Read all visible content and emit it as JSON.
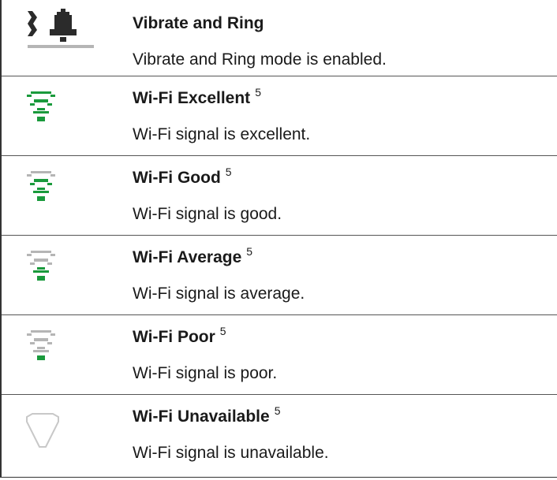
{
  "colors": {
    "green": "#1a9a3c",
    "gray": "#b5b5b5",
    "dark": "#1a1a1a",
    "icon_dark": "#2b2b2b"
  },
  "rows": [
    {
      "icon": "vibrate-and-ring-icon",
      "title": "Vibrate and Ring",
      "footnote": "",
      "description": "Vibrate and Ring mode is enabled."
    },
    {
      "icon": "wifi-excellent-icon",
      "title": "Wi-Fi Excellent",
      "footnote": "5",
      "description": "Wi-Fi signal is excellent."
    },
    {
      "icon": "wifi-good-icon",
      "title": "Wi-Fi Good",
      "footnote": "5",
      "description": "Wi-Fi signal is good."
    },
    {
      "icon": "wifi-average-icon",
      "title": "Wi-Fi Average",
      "footnote": "5",
      "description": "Wi-Fi signal is average."
    },
    {
      "icon": "wifi-poor-icon",
      "title": "Wi-Fi Poor",
      "footnote": "5",
      "description": "Wi-Fi signal is poor."
    },
    {
      "icon": "wifi-unavailable-icon",
      "title": "Wi-Fi Unavailable",
      "footnote": "5",
      "description": "Wi-Fi signal is unavailable."
    }
  ]
}
